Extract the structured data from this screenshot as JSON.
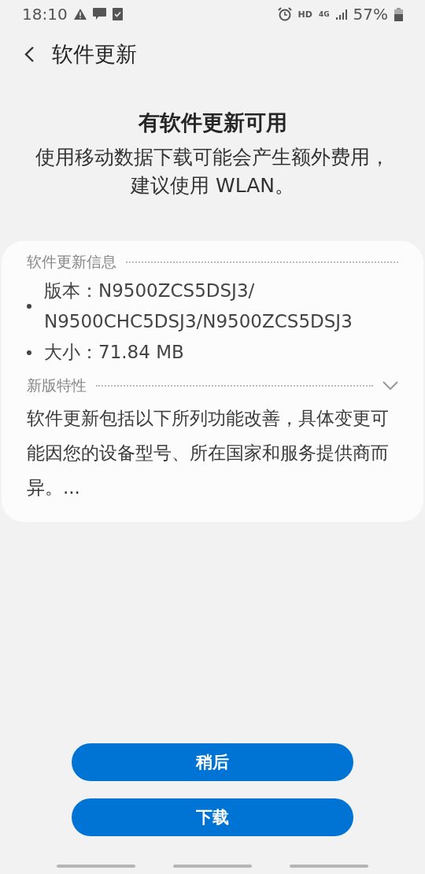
{
  "status_bar": {
    "time": "18:10",
    "hd": "HD",
    "network": "4G",
    "battery": "57%"
  },
  "header": {
    "title": "软件更新"
  },
  "heading": "有软件更新可用",
  "subtitle": "使用移动数据下载可能会产生额外费用，建议使用 WLAN。",
  "info": {
    "title": "软件更新信息",
    "items": [
      "版本：N9500ZCS5DSJ3/ N9500CHC5DSJ3/N9500ZCS5DSJ3",
      "大小：71.84 MB"
    ]
  },
  "features": {
    "title": "新版特性",
    "text": "软件更新包括以下所列功能改善，具体变更可能因您的设备型号、所在国家和服务提供商而异。..."
  },
  "buttons": [
    "稍后",
    "下载"
  ]
}
